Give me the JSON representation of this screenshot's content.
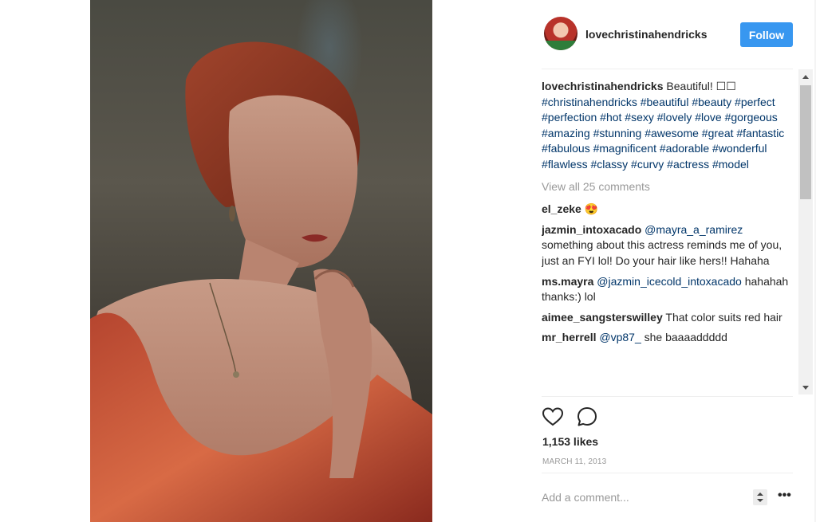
{
  "post": {
    "username": "lovechristinahendricks",
    "follow_label": "Follow",
    "caption_username": "lovechristinahendricks",
    "caption_text": " Beautiful! ☐☐",
    "hashtags": "#christinahendricks #beautiful #beauty #perfect #perfection #hot #sexy #lovely #love #gorgeous #amazing #stunning #awesome #great #fantastic #fabulous #magnificent #adorable #wonderful #flawless #classy #curvy #actress #model",
    "view_all_comments": "View all 25 comments",
    "comments": [
      {
        "user": "el_zeke",
        "mention": "",
        "text": " 😍"
      },
      {
        "user": "jazmin_intoxacado",
        "mention": " @mayra_a_ramirez",
        "text": " something about this actress reminds me of you, just an FYI lol! Do your hair like hers!! Hahaha"
      },
      {
        "user": "ms.mayra",
        "mention": " @jazmin_icecold_intoxacado",
        "text": " hahahah thanks:) lol"
      },
      {
        "user": "aimee_sangsterswilley",
        "mention": "",
        "text": " That color suits red hair"
      },
      {
        "user": "mr_herrell",
        "mention": " @vp87_",
        "text": " she baaaaddddd"
      }
    ],
    "likes": "1,153 likes",
    "date": "MARCH 11, 2013",
    "add_comment_placeholder": "Add a comment...",
    "more_label": "•••"
  },
  "icons": {
    "like": "heart-icon",
    "comment": "comment-bubble-icon",
    "more": "more-options-icon"
  },
  "colors": {
    "follow_button": "#3897f0",
    "hashtag": "#003569",
    "muted": "#999999",
    "text": "#262626"
  }
}
